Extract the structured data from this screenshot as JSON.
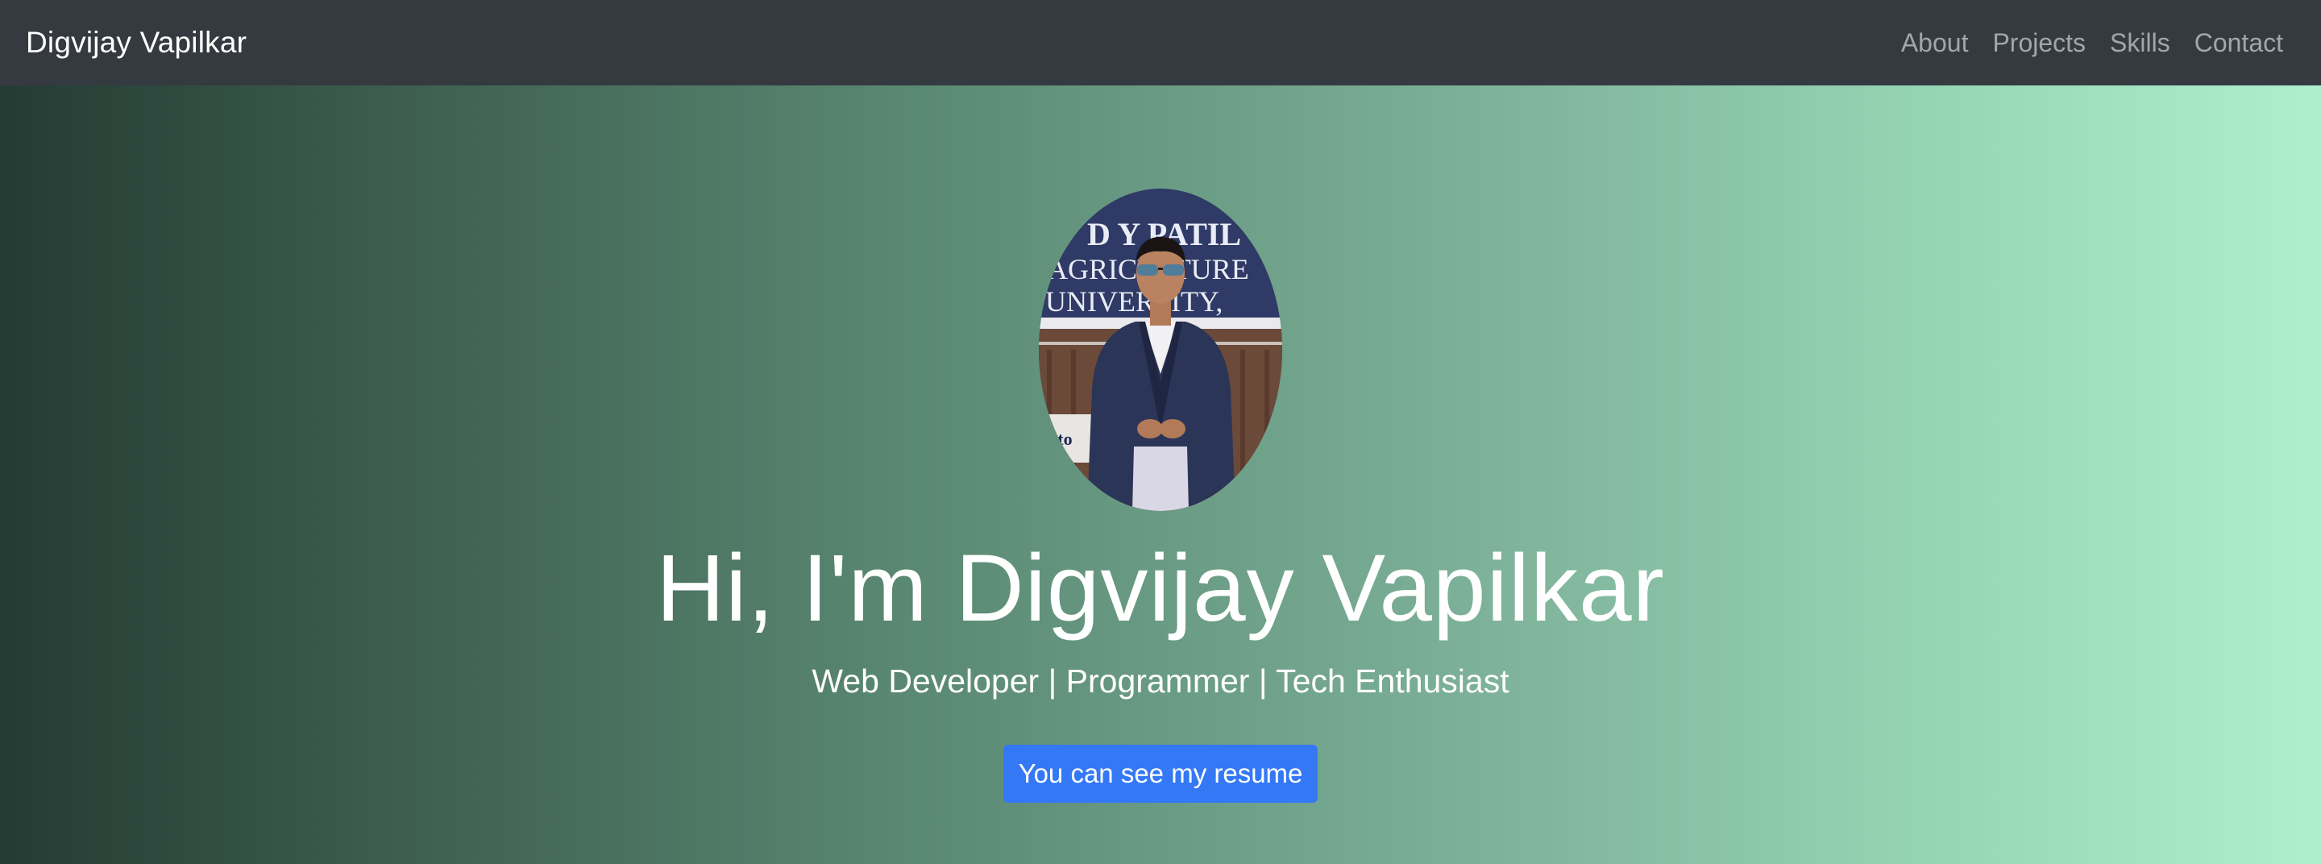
{
  "navbar": {
    "brand": "Digvijay Vapilkar",
    "links": [
      {
        "label": "About"
      },
      {
        "label": "Projects"
      },
      {
        "label": "Skills"
      },
      {
        "label": "Contact"
      }
    ],
    "background": "#343a40"
  },
  "hero": {
    "photo": {
      "sign_text_lines": [
        "D Y PATIL",
        "AGRICULTURE",
        "UNIVERSITY,"
      ],
      "sign_fragment": "e to"
    },
    "title": "Hi, I'm Digvijay Vapilkar",
    "subtitle": "Web Developer | Programmer | Tech Enthusiast",
    "resume_button": "You can see my resume",
    "gradient_colors": [
      "#243b33",
      "#aeefcd"
    ],
    "button_color": "#3478f6"
  }
}
